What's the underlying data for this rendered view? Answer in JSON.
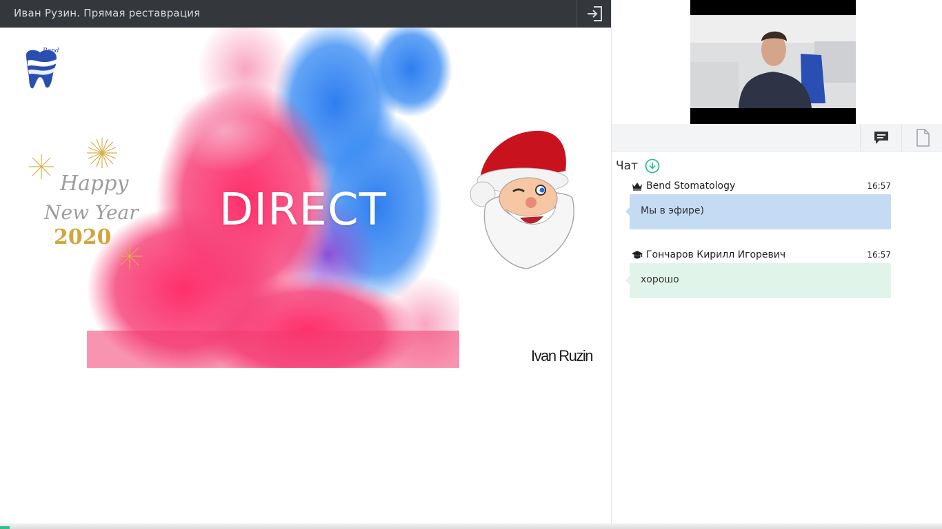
{
  "header": {
    "title": "Иван Рузин. Прямая реставрация",
    "exit_icon": "sign-in-icon"
  },
  "slide": {
    "headline": "DIRECT",
    "signature": "Ivan Ruzin",
    "logo_text": "Bend",
    "greeting_lines": [
      "Happy",
      "New Year",
      "2020"
    ]
  },
  "tabs": [
    {
      "name": "chat",
      "icon": "chat-bubble-icon"
    },
    {
      "name": "files",
      "icon": "document-icon"
    }
  ],
  "chat": {
    "title": "Чат",
    "download_icon": "download-circle-icon",
    "messages": [
      {
        "author": "Bend Stomatology",
        "role_icon": "crown-icon",
        "time": "16:57",
        "text": "Мы в эфире)",
        "color": "#c5daf3"
      },
      {
        "author": "Гончаров Кирилл Игоревич",
        "role_icon": "graduation-cap-icon",
        "time": "16:57",
        "text": "хорошо",
        "color": "#e0f4ea"
      }
    ]
  },
  "colors": {
    "topbar": "#34373b",
    "accent": "#2fc08c"
  }
}
